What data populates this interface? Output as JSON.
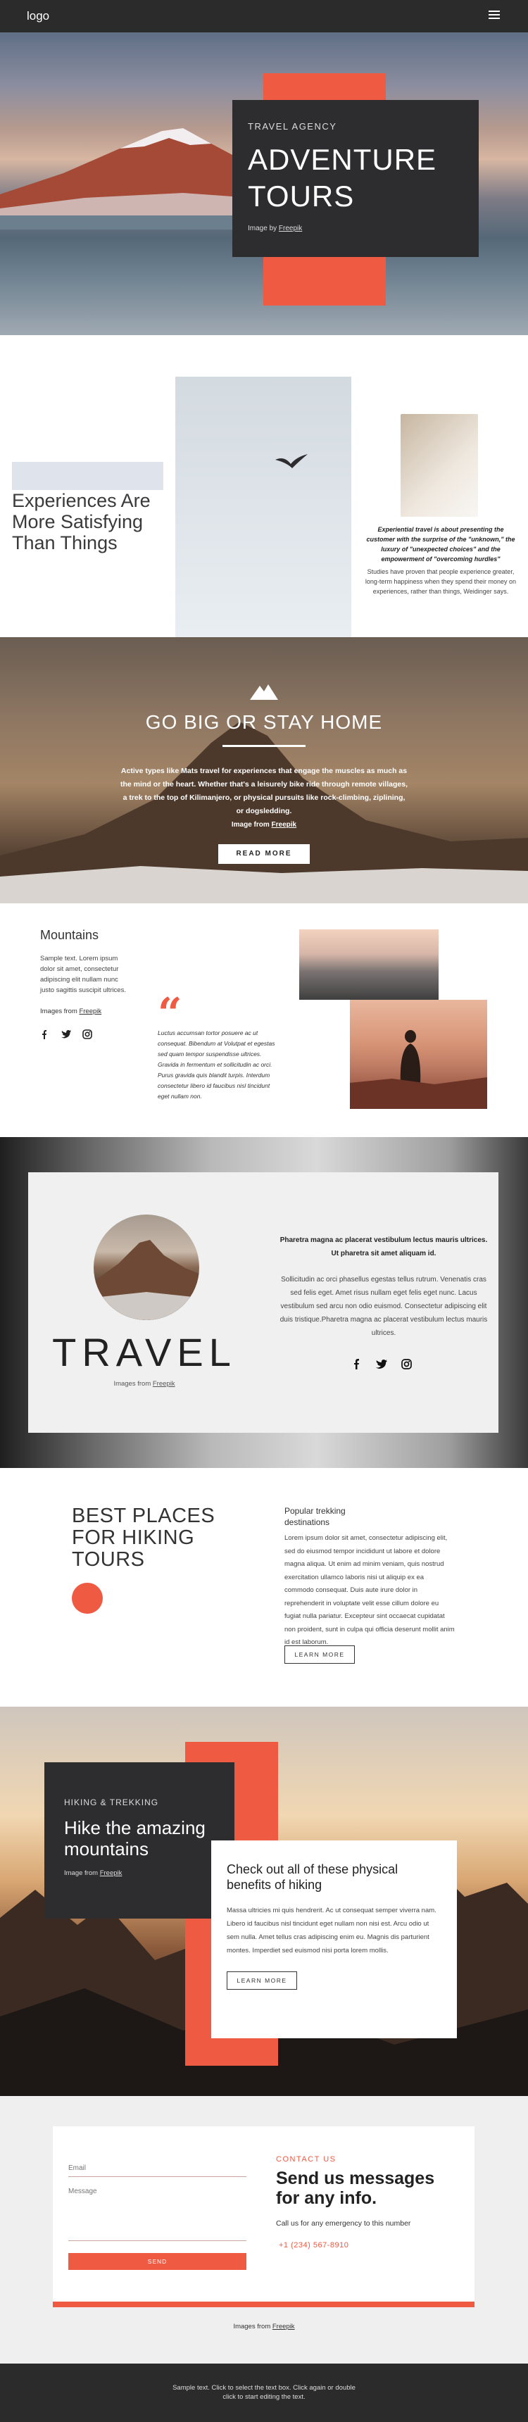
{
  "header": {
    "logo": "logo"
  },
  "hero": {
    "eyebrow": "TRAVEL AGENCY",
    "title_line1": "ADVENTURE",
    "title_line2": "TOURS",
    "credit_prefix": "Image by ",
    "credit_link": "Freepik"
  },
  "experiences": {
    "title": "Experiences Are More Satisfying Than Things",
    "quote": "Experiential travel is about presenting the customer with the surprise of the \"unknown,\" the luxury of \"unexpected choices\" and the empowerment of \"overcoming hurdles\"",
    "text": "Studies have proven that people experience greater, long-term happiness when they spend their money on experiences, rather than things, Weidinger says."
  },
  "gobig": {
    "title": "GO BIG OR STAY HOME",
    "text": "Active types like Mats travel for experiences that engage the muscles as much as the mind or the heart. Whether that's a leisurely bike ride through remote villages, a trek to the top of Kilimanjero, or physical pursuits like rock-climbing, ziplining, or dogsledding.",
    "credit_prefix": "Image from ",
    "credit_link": "Freepik",
    "button": "READ MORE"
  },
  "mountains": {
    "title": "Mountains",
    "text": "Sample text. Lorem ipsum dolor sit amet, consectetur adipiscing elit nullam nunc justo sagittis suscipit ultrices.",
    "credit_prefix": "Images from ",
    "credit_link": "Freepik",
    "quote_mark": "“",
    "quote_text": "Luctus accumsan tortor posuere ac ut consequat. Bibendum at Volutpat et egestas sed quam tempor suspendisse ultrices. Gravida in fermentum et sollicitudin ac orci. Purus gravida quis blandit turpis. Interdum consectetur libero id faucibus nisl tincidunt eget nullam non."
  },
  "travel": {
    "word": "TRAVEL",
    "credit_prefix": "Images from ",
    "credit_link": "Freepik",
    "bold_text": "Pharetra magna ac placerat vestibulum lectus mauris ultrices. Ut pharetra sit amet aliquam id.",
    "text": "Sollicitudin ac orci phasellus egestas tellus rutrum. Venenatis cras sed felis eget. Amet risus nullam eget felis eget nunc. Lacus vestibulum sed arcu non odio euismod. Consectetur adipiscing elit duis tristique.Pharetra magna ac placerat vestibulum lectus mauris ultrices."
  },
  "best_places": {
    "title": "BEST PLACES FOR HIKING TOURS",
    "subtitle": "Popular trekking destinations",
    "text": "Lorem ipsum dolor sit amet, consectetur adipiscing elit, sed do eiusmod tempor incididunt ut labore et dolore magna aliqua. Ut enim ad minim veniam, quis nostrud exercitation ullamco laboris nisi ut aliquip ex ea commodo consequat. Duis aute irure dolor in reprehenderit in voluptate velit esse cillum dolore eu fugiat nulla pariatur. Excepteur sint occaecat cupidatat non proident, sunt in culpa qui officia deserunt mollit anim id est laborum.",
    "button": "LEARN MORE"
  },
  "hike": {
    "eyebrow": "HIKING & TREKKING",
    "title": "Hike the amazing mountains",
    "credit_prefix": "Image from ",
    "credit_link": "Freepik",
    "card_title": "Check out all of these physical benefits of hiking",
    "card_text": "Massa ultricies mi quis hendrerit. Ac ut consequat semper viverra nam. Libero id faucibus nisl tincidunt eget nullam non nisi est. Arcu odio ut sem nulla. Amet tellus cras adipiscing enim eu. Magnis dis parturient montes. Imperdiet sed euismod nisi porta lorem mollis.",
    "button": "LEARN MORE"
  },
  "contact": {
    "email_placeholder": "Email",
    "message_placeholder": "Message",
    "send": "SEND",
    "eyebrow": "CONTACT US",
    "title": "Send us messages for any info.",
    "call": "Call us for any emergency to this number",
    "phone": "+1 (234) 567-8910",
    "credit_prefix": "Images from ",
    "credit_link": "Freepik"
  },
  "footer": {
    "line1": "Sample text. Click to select the text box. Click again or double",
    "line2": "click to start editing the text."
  },
  "colors": {
    "accent": "#ef5a43",
    "dark": "#2d2c2e"
  },
  "icons": [
    "hamburger-icon",
    "mountain-logo-icon",
    "facebook-icon",
    "twitter-icon",
    "instagram-icon",
    "bird-icon",
    "quote-icon"
  ]
}
